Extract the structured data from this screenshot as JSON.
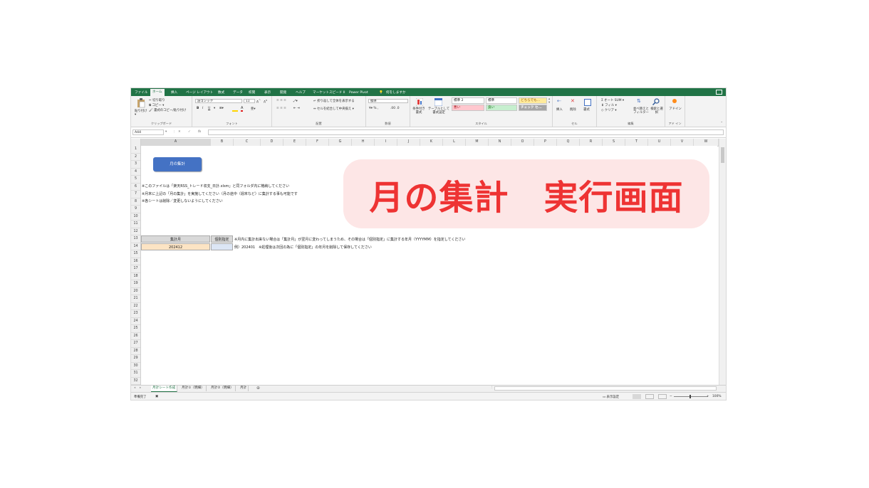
{
  "ribbon_tabs": [
    "ファイル",
    "ホーム",
    "挿入",
    "ページ レイアウト",
    "数式",
    "データ",
    "校閲",
    "表示",
    "開発",
    "ヘルプ",
    "マーケットスピード II",
    "Power Pivot",
    "何をしますか"
  ],
  "ribbon": {
    "clipboard": {
      "paste": "貼り付け",
      "cut": "切り取り",
      "copy": "コピー",
      "format_painter": "書式のコピー/貼り付け",
      "label": "クリップボード"
    },
    "font": {
      "name": "游ゴシック",
      "size": "11",
      "bold": "B",
      "italic": "I",
      "underline": "U",
      "label": "フォント"
    },
    "alignment": {
      "wrap": "折り返して全体を表示する",
      "merge": "セルを結合して中央揃え",
      "label": "配置"
    },
    "number": {
      "format": "標準",
      "label": "数値"
    },
    "styles": {
      "conditional": "条件付き書式",
      "table": "テーブルとして書式設定",
      "cells": [
        "標準 2",
        "標準",
        "どちらでも...",
        "悪い",
        "良い",
        "チェック セ..."
      ],
      "label": "スタイル"
    },
    "cells": {
      "insert": "挿入",
      "delete": "削除",
      "format": "書式",
      "label": "セル"
    },
    "editing": {
      "autosum": "オート SUM",
      "fill": "フィル",
      "clear": "クリア",
      "sort": "並べ替えとフィルター",
      "find": "検索と選択",
      "label": "編集"
    },
    "addin": {
      "label": "アド イン",
      "addin": "アドイン"
    }
  },
  "formula_bar": {
    "name_box": "A44",
    "fx": "fx"
  },
  "columns": [
    "A",
    "B",
    "C",
    "D",
    "E",
    "F",
    "G",
    "H",
    "I",
    "J",
    "K",
    "L",
    "M",
    "N",
    "O",
    "P",
    "Q",
    "R",
    "S",
    "T",
    "U",
    "V",
    "W"
  ],
  "rows": [
    "1",
    "2",
    "3",
    "4",
    "5",
    "6",
    "7",
    "8",
    "9",
    "10",
    "11",
    "12",
    "13",
    "14",
    "15",
    "16",
    "17",
    "18",
    "19",
    "20",
    "21",
    "22",
    "23",
    "24",
    "25",
    "26",
    "27",
    "28",
    "29",
    "30",
    "31",
    "32",
    "33"
  ],
  "sheet": {
    "button_label": "月の集計",
    "notes": [
      "※このファイルは「楽天RSS_トレード収支_日計.xlsm」と同フォルダ内に格納してください",
      "※月末に上記の「月の集計」を実施してください（月の途中（週末など）に集計する事も可能です",
      "※各シートは削除／変更しないようにしてください"
    ],
    "header_a": "集計月",
    "header_b": "個別指定",
    "value_a": "202412",
    "note_r13": "※月内に集計出来ない場合は「集計月」が翌月に変わってしまうため、その場合は「個別指定」に集計する年月（YYYYMM）を指定してください",
    "note_r14": "例）202401　※処理後は次回の為に「個別指定」の年月を削除して保存してください"
  },
  "sheet_tabs": [
    "月計シート作成",
    "月計①（明細）",
    "月計②（明細）",
    "月計"
  ],
  "status": {
    "ready": "準備完了",
    "display_settings": "表示設定",
    "zoom": "100%"
  },
  "overlay_caption": "月の集計　実行画面",
  "colors": {
    "excel_green": "#217346",
    "button_blue": "#4472c4",
    "header_fill": "#d9d9d9",
    "value_fill": "#fce4c4",
    "overlay_bg": "#fde6e6",
    "overlay_text": "#ee3333"
  }
}
